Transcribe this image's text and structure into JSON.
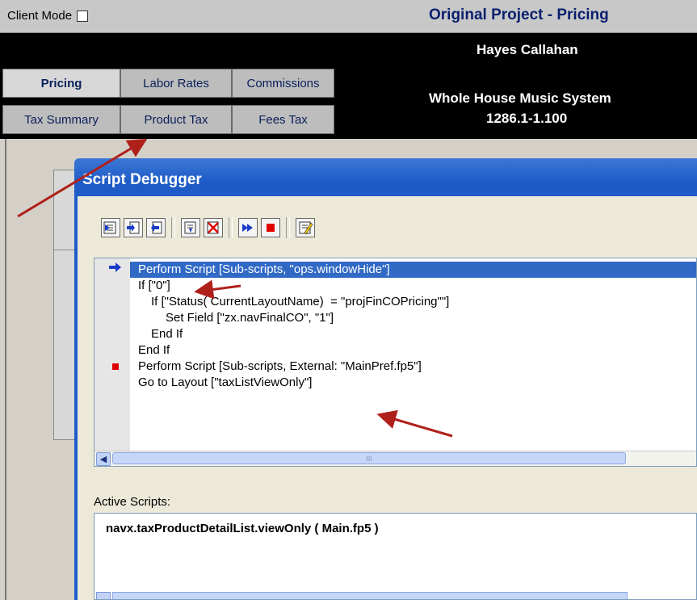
{
  "header": {
    "client_mode_label": "Client Mode",
    "project_title": "Original Project - Pricing",
    "client_name": "Hayes Callahan",
    "system_name": "Whole House Music System",
    "system_code": "1286.1-1.100"
  },
  "tabs": {
    "pricing": "Pricing",
    "labor_rates": "Labor Rates",
    "commissions": "Commissions",
    "tax_summary": "Tax Summary",
    "product_tax": "Product Tax",
    "fees_tax": "Fees Tax"
  },
  "debugger": {
    "title": "Script Debugger",
    "toolbar": [
      "step-over-icon",
      "step-into-icon",
      "step-out-icon",
      "set-next-step-icon",
      "clear-breakpoints-icon",
      "run-icon",
      "halt-icon",
      "edit-script-icon"
    ],
    "script_lines": [
      "Perform Script [Sub-scripts, \"ops.windowHide\"]",
      "If [\"0\"]",
      "If [\"Status( CurrentLayoutName)  = \"projFinCOPricing\"\"]",
      "Set Field [\"zx.navFinalCO\", \"1\"]",
      "End If",
      "End If",
      "Perform Script [Sub-scripts, External: \"MainPref.fp5\"]",
      "Go to Layout [\"taxListViewOnly\"]"
    ],
    "scroll_thumb_glyph": "III",
    "active_scripts_label": "Active Scripts:",
    "active_scripts": [
      "navx.taxProductDetailList.viewOnly ( Main.fp5 )"
    ]
  },
  "colors": {
    "header_title": "#0a1f6e",
    "highlight": "#316ac5",
    "titlebar": "#1f5cc8",
    "annotation_arrow": "#b0201a"
  }
}
